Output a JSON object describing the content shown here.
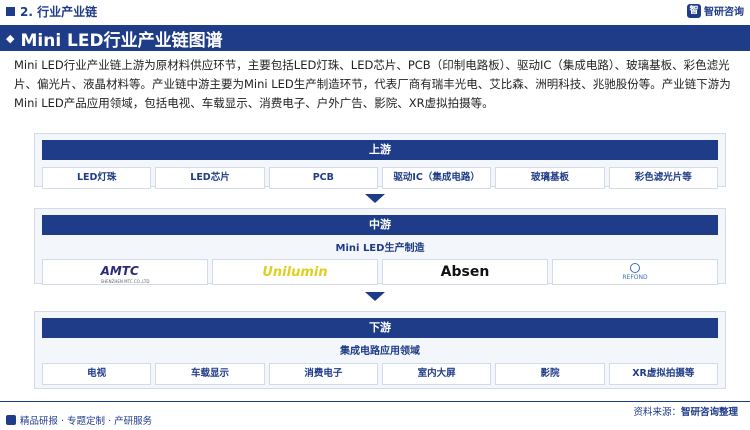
{
  "header": {
    "section_title": "2. 行业产业链",
    "logo_text": "智研咨询"
  },
  "banner": {
    "title": "Mini LED行业产业链图谱"
  },
  "intro": "Mini LED行业产业链上游为原材料供应环节，主要包括LED灯珠、LED芯片、PCB（印制电路板）、驱动IC（集成电路）、玻璃基板、彩色滤光片、偏光片、液晶材料等。产业链中游主要为Mini LED生产制造环节，代表厂商有瑞丰光电、艾比森、洲明科技、兆驰股份等。产业链下游为Mini LED产品应用领域，包括电视、车载显示、消费电子、户外广告、影院、XR虚拟拍摄等。",
  "upstream": {
    "title": "上游",
    "items": [
      "LED灯珠",
      "LED芯片",
      "PCB",
      "驱动IC（集成电路）",
      "玻璃基板",
      "彩色滤光片等"
    ]
  },
  "midstream": {
    "title": "中游",
    "subtitle": "Mini LED生产制造",
    "logos": {
      "amtc": "AMTC",
      "amtc_sub": "SHENZHEN MTC CO.,LTD",
      "unilumin": "Unilumin",
      "absen": "Absen",
      "refond": "REFOND"
    }
  },
  "downstream": {
    "title": "下游",
    "subtitle": "集成电路应用领域",
    "items": [
      "电视",
      "车载显示",
      "消费电子",
      "室内大屏",
      "影院",
      "XR虚拟拍摄等"
    ]
  },
  "footer": {
    "left": "精品研报 · 专题定制 · 产研服务",
    "source_label": "资料来源：",
    "source_value": "智研咨询整理"
  }
}
